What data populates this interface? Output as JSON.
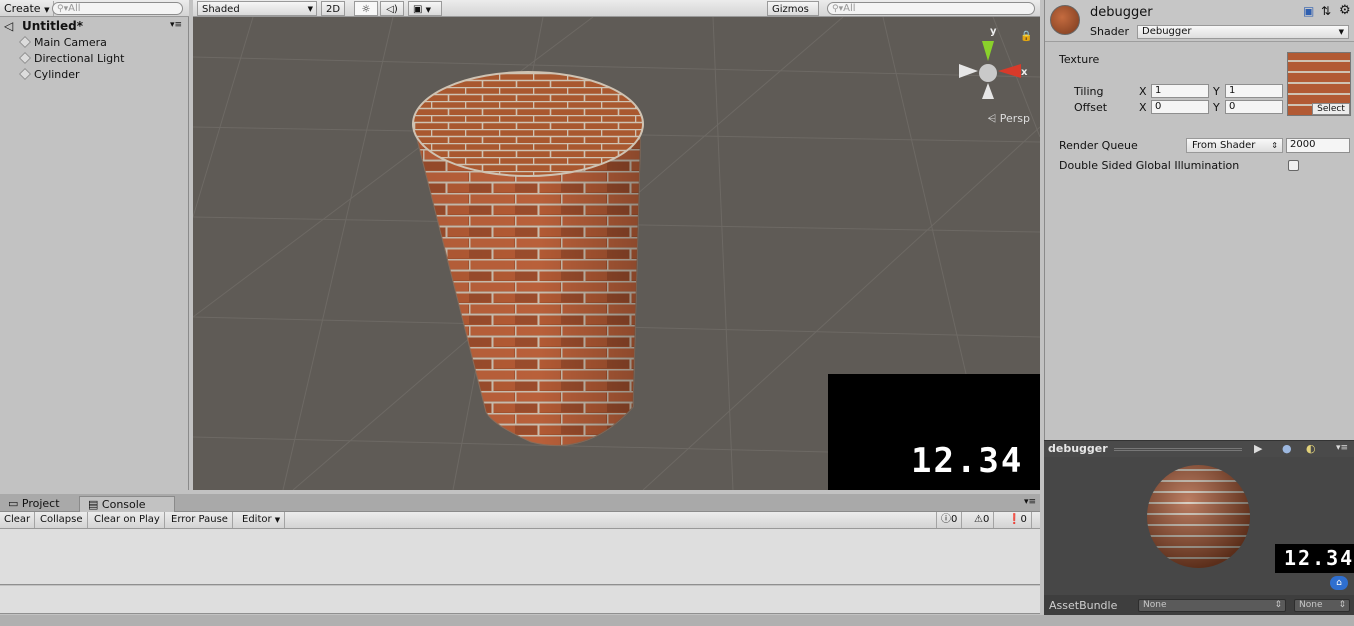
{
  "hierarchy": {
    "create_label": "Create",
    "search_placeholder": "All",
    "scene_name": "Untitled*",
    "items": [
      "Main Camera",
      "Directional Light",
      "Cylinder"
    ]
  },
  "scene_toolbar": {
    "shading_mode": "Shaded",
    "mode_2d": "2D",
    "gizmos_label": "Gizmos",
    "search_placeholder": "All"
  },
  "scene_view": {
    "persp_label": "Persp",
    "axis_x": "x",
    "axis_y": "y",
    "overlay_value": "12.34"
  },
  "console": {
    "tabs": [
      "Project",
      "Console"
    ],
    "active_tab": "Console",
    "toolbar": {
      "clear": "Clear",
      "collapse": "Collapse",
      "clear_on_play": "Clear on Play",
      "error_pause": "Error Pause",
      "editor": "Editor"
    },
    "counts": {
      "info": "0",
      "warning": "0",
      "error": "0"
    }
  },
  "inspector": {
    "material_name": "debugger",
    "shader_label": "Shader",
    "shader_value": "Debugger",
    "texture_label": "Texture",
    "tiling_label": "Tiling",
    "offset_label": "Offset",
    "x_label": "X",
    "y_label": "Y",
    "tiling_x": "1",
    "tiling_y": "1",
    "offset_x": "0",
    "offset_y": "0",
    "select_label": "Select",
    "render_queue_label": "Render Queue",
    "render_queue_mode": "From Shader",
    "render_queue_value": "2000",
    "double_sided_gi_label": "Double Sided Global Illumination",
    "double_sided_gi_checked": false
  },
  "preview": {
    "title": "debugger",
    "overlay_value": "12.34",
    "assetbundle_label": "AssetBundle",
    "assetbundle_name": "None",
    "assetbundle_variant": "None"
  },
  "colors": {
    "scene_bg": "#5f5b56",
    "panel_bg": "#c2c2c2",
    "brick": "#a5532f",
    "mortar": "#c9bdae",
    "preview_bg": "#474747",
    "axis_x": "#d83a2a",
    "axis_y": "#8ad12b"
  }
}
